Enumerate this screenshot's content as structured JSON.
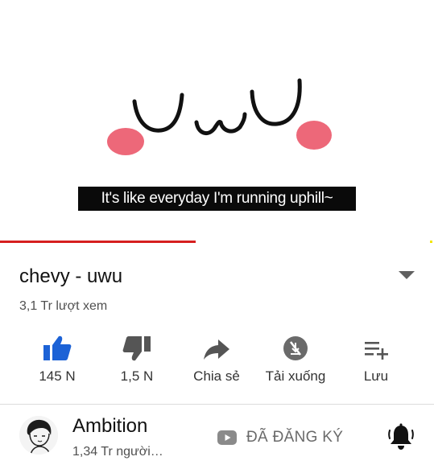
{
  "video": {
    "subtitle": "It's like everyday I'm running uphill~",
    "progress": 0.45
  },
  "info": {
    "title": "chevy - uwu",
    "views": "3,1 Tr lượt xem",
    "expand_icon": "chevron-down-icon"
  },
  "actions": [
    {
      "icon": "thumbs-up-icon",
      "label": "145 N",
      "color": "#1c62d6"
    },
    {
      "icon": "thumbs-down-icon",
      "label": "1,5 N",
      "color": "#555555"
    },
    {
      "icon": "share-icon",
      "label": "Chia sẻ",
      "color": "#555555"
    },
    {
      "icon": "download-icon",
      "label": "Tải xuống",
      "color": "#555555"
    },
    {
      "icon": "add-to-playlist-icon",
      "label": "Lưu",
      "color": "#555555"
    }
  ],
  "channel": {
    "name": "Ambition",
    "subscribers": "1,34 Tr người…",
    "subscribed_label": "ĐÃ ĐĂNG KÝ",
    "bell_icon": "notification-bell-icon"
  },
  "colors": {
    "progress": "#d61f1f",
    "like_active": "#1c62d6",
    "blush": "#ec5b6e"
  }
}
